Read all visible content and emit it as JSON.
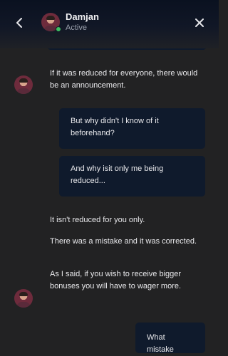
{
  "header": {
    "agent_name": "Damjan",
    "agent_status": "Active",
    "back_icon": "chevron-left-icon",
    "close_icon": "close-icon"
  },
  "messages": [
    {
      "from": "agent",
      "text": "If it was reduced for everyone, there would be an announcement."
    },
    {
      "from": "user",
      "text": "But why didn't I know of it beforehand?"
    },
    {
      "from": "user",
      "text": "And why isit only me being reduced..."
    },
    {
      "from": "agent",
      "text": "It isn't reduced for you only."
    },
    {
      "from": "agent",
      "text": "There was a mistake and it was corrected."
    },
    {
      "from": "agent",
      "text": "As I said, if you wish to receive bigger bonuses you will have to wager more."
    },
    {
      "from": "user",
      "text": "What mistake"
    }
  ],
  "colors": {
    "background": "#222223",
    "header": "#111726",
    "user_bubble": "#0f1a2c",
    "status_active": "#3fbf62"
  }
}
